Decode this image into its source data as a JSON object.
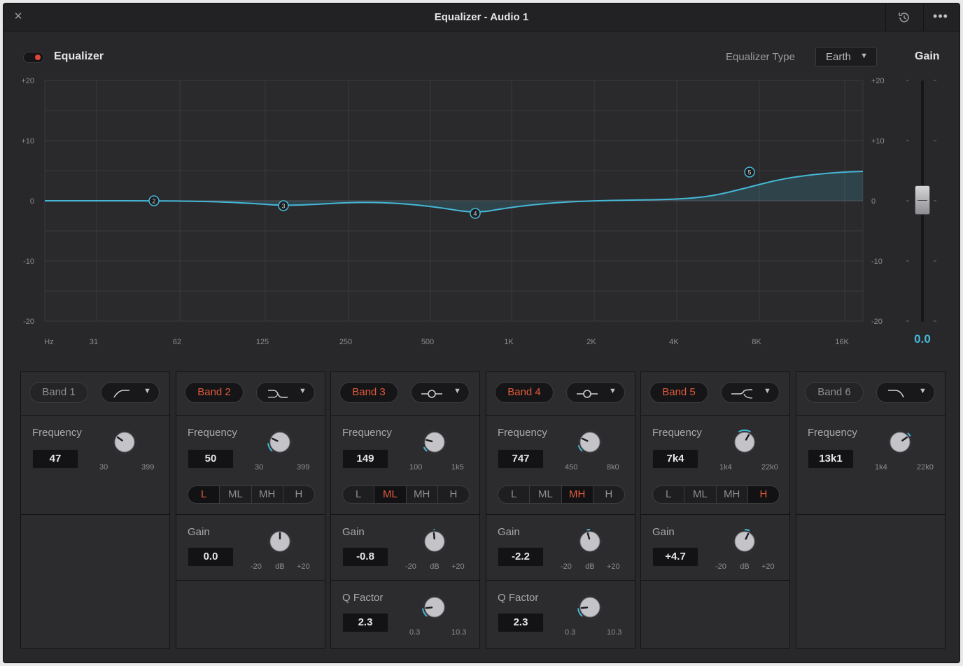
{
  "window": {
    "title": "Equalizer - Audio 1",
    "close_icon": "close-icon",
    "reset_icon": "reset-history-icon",
    "more_icon": "more-options-icon"
  },
  "header": {
    "enable_label": "Equalizer",
    "enabled": true,
    "type_label": "Equalizer Type",
    "type_value": "Earth",
    "gain_label": "Gain"
  },
  "graph": {
    "y_ticks": [
      "+20",
      "+10",
      "0",
      "-10",
      "-20"
    ],
    "x_ticks": [
      "Hz",
      "31",
      "62",
      "125",
      "250",
      "500",
      "1K",
      "2K",
      "4K",
      "8K",
      "16K"
    ],
    "markers": [
      "2",
      "3",
      "4",
      "5"
    ]
  },
  "gain": {
    "ticks": [
      "+20",
      "+10",
      "0",
      "-10",
      "-20"
    ],
    "value": "0.0"
  },
  "colors": {
    "accent": "#46b8d6",
    "active_text": "#e05a3c",
    "background": "#28282b"
  },
  "bands": [
    {
      "label": "Band 1",
      "active": false,
      "filter_icon": "high-pass-filter-icon",
      "frequency": {
        "label": "Frequency",
        "value": "47",
        "min": "30",
        "max": "399"
      },
      "range": null,
      "gain": null,
      "q": null
    },
    {
      "label": "Band 2",
      "active": true,
      "filter_icon": "low-shelf-filter-icon",
      "frequency": {
        "label": "Frequency",
        "value": "50",
        "min": "30",
        "max": "399"
      },
      "range": {
        "options": [
          "L",
          "ML",
          "MH",
          "H"
        ],
        "selected": "L"
      },
      "gain": {
        "label": "Gain",
        "value": "0.0",
        "min": "-20",
        "unit": "dB",
        "max": "+20"
      },
      "q": null
    },
    {
      "label": "Band 3",
      "active": true,
      "filter_icon": "bell-filter-icon",
      "frequency": {
        "label": "Frequency",
        "value": "149",
        "min": "100",
        "max": "1k5"
      },
      "range": {
        "options": [
          "L",
          "ML",
          "MH",
          "H"
        ],
        "selected": "ML"
      },
      "gain": {
        "label": "Gain",
        "value": "-0.8",
        "min": "-20",
        "unit": "dB",
        "max": "+20"
      },
      "q": {
        "label": "Q Factor",
        "value": "2.3",
        "min": "0.3",
        "max": "10.3"
      }
    },
    {
      "label": "Band 4",
      "active": true,
      "filter_icon": "bell-filter-icon",
      "frequency": {
        "label": "Frequency",
        "value": "747",
        "min": "450",
        "max": "8k0"
      },
      "range": {
        "options": [
          "L",
          "ML",
          "MH",
          "H"
        ],
        "selected": "MH"
      },
      "gain": {
        "label": "Gain",
        "value": "-2.2",
        "min": "-20",
        "unit": "dB",
        "max": "+20"
      },
      "q": {
        "label": "Q Factor",
        "value": "2.3",
        "min": "0.3",
        "max": "10.3"
      }
    },
    {
      "label": "Band 5",
      "active": true,
      "filter_icon": "high-shelf-filter-icon",
      "frequency": {
        "label": "Frequency",
        "value": "7k4",
        "min": "1k4",
        "max": "22k0"
      },
      "range": {
        "options": [
          "L",
          "ML",
          "MH",
          "H"
        ],
        "selected": "H"
      },
      "gain": {
        "label": "Gain",
        "value": "+4.7",
        "min": "-20",
        "unit": "dB",
        "max": "+20"
      },
      "q": null
    },
    {
      "label": "Band 6",
      "active": false,
      "filter_icon": "low-pass-filter-icon",
      "frequency": {
        "label": "Frequency",
        "value": "13k1",
        "min": "1k4",
        "max": "22k0"
      },
      "range": null,
      "gain": null,
      "q": null
    }
  ]
}
